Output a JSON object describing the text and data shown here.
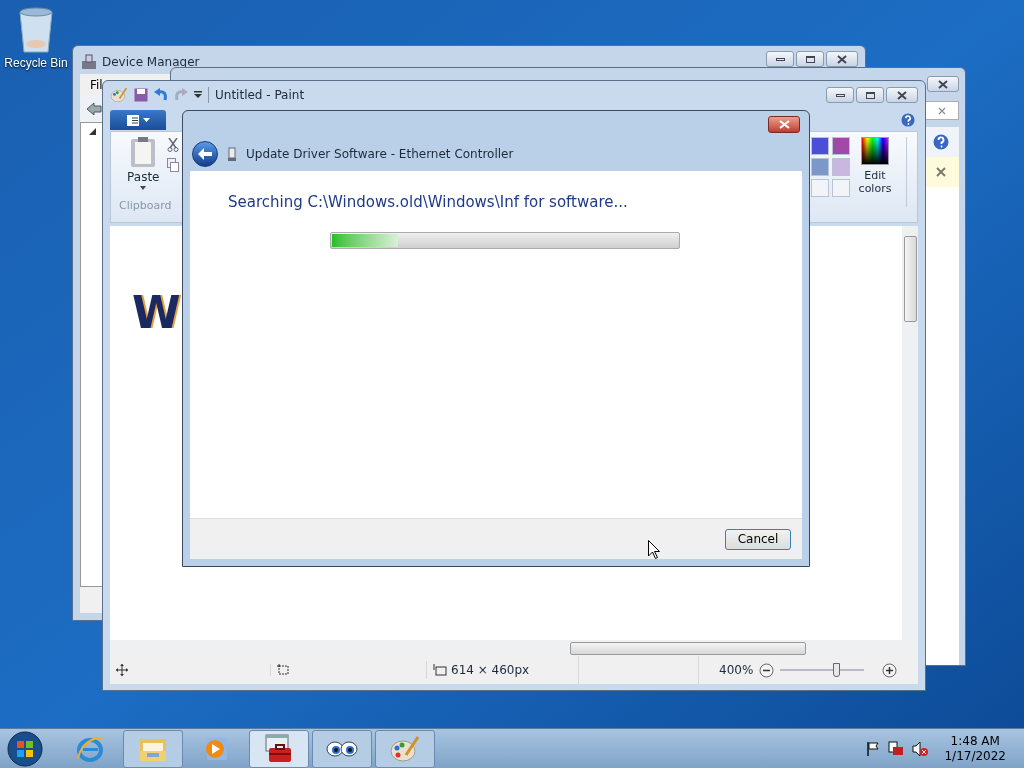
{
  "desktop_icons": [
    {
      "label": "Recycle Bin"
    }
  ],
  "device_manager": {
    "title": "Device Manager",
    "menu": [
      "Fil"
    ]
  },
  "paint": {
    "title": "Untitled - Paint",
    "ribbon": {
      "paste": "Paste",
      "group": "Clipboard",
      "edit_colors": "Edit colors",
      "palette": [
        {
          "color": "#4a4ed8"
        },
        {
          "color": "#a04aa8"
        },
        {
          "color": "#7b98c8"
        },
        {
          "color": "#c8b8e0"
        },
        {
          "color": "#f2f4f8"
        },
        {
          "color": "#f2f4f8"
        }
      ]
    },
    "canvas_text": "W",
    "status": {
      "size": "614 × 460px",
      "zoom": "400%",
      "zoom_slider": {
        "level": 0.68
      }
    }
  },
  "dialog": {
    "title": "Update Driver Software - Ethernet Controller",
    "status_text": "Searching C:\\Windows.old\\Windows\\Inf for software...",
    "progress": {
      "level": 0.19
    },
    "buttons": [
      "Cancel"
    ]
  },
  "taskbar": {
    "items": [
      {
        "kind": "ie",
        "running": false,
        "active": false
      },
      {
        "kind": "explorer",
        "running": true,
        "active": false
      },
      {
        "kind": "media",
        "running": false,
        "active": false
      },
      {
        "kind": "toolbox",
        "running": true,
        "active": true
      },
      {
        "kind": "eyes",
        "running": true,
        "active": false
      },
      {
        "kind": "paint",
        "running": true,
        "active": false
      }
    ],
    "clock": {
      "time": "1:48 AM",
      "date": "1/17/2022"
    }
  }
}
